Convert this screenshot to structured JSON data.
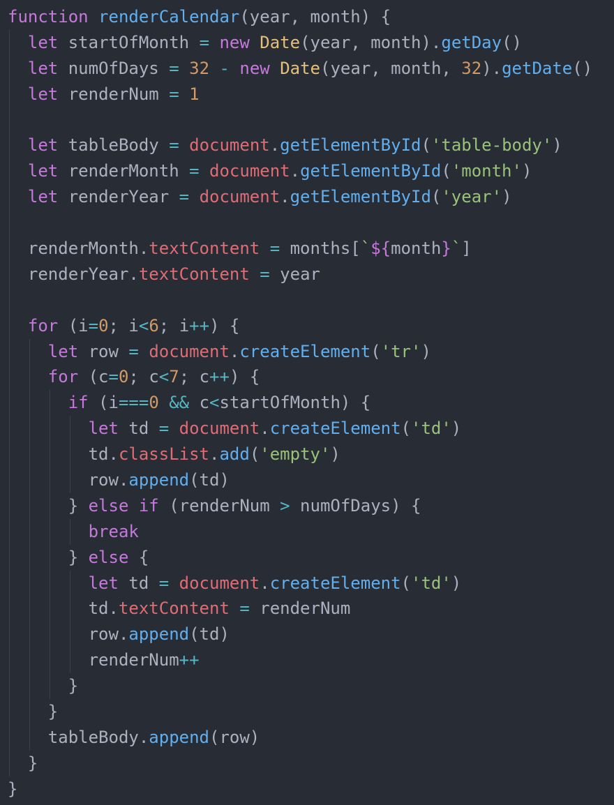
{
  "editor": {
    "colors": {
      "background": "#282c34",
      "plain": "#abb2bf",
      "keyword": "#c678dd",
      "function": "#61afef",
      "class": "#e5c07b",
      "number": "#d19a66",
      "string": "#98c379",
      "property": "#e06c75",
      "operator": "#56b6c2",
      "indent_guide": "#3b4048"
    },
    "lines": [
      {
        "indent": 0,
        "tokens": [
          {
            "t": "function",
            "c": "keyword"
          },
          {
            "t": " ",
            "c": "plain"
          },
          {
            "t": "renderCalendar",
            "c": "func"
          },
          {
            "t": "(year, month) {",
            "c": "plain"
          }
        ]
      },
      {
        "indent": 1,
        "tokens": [
          {
            "t": "let",
            "c": "keyword"
          },
          {
            "t": " startOfMonth ",
            "c": "plain"
          },
          {
            "t": "=",
            "c": "op"
          },
          {
            "t": " ",
            "c": "plain"
          },
          {
            "t": "new",
            "c": "keyword"
          },
          {
            "t": " ",
            "c": "plain"
          },
          {
            "t": "Date",
            "c": "class"
          },
          {
            "t": "(year, month).",
            "c": "plain"
          },
          {
            "t": "getDay",
            "c": "method"
          },
          {
            "t": "()",
            "c": "plain"
          }
        ]
      },
      {
        "indent": 1,
        "tokens": [
          {
            "t": "let",
            "c": "keyword"
          },
          {
            "t": " numOfDays ",
            "c": "plain"
          },
          {
            "t": "=",
            "c": "op"
          },
          {
            "t": " ",
            "c": "plain"
          },
          {
            "t": "32",
            "c": "num"
          },
          {
            "t": " ",
            "c": "plain"
          },
          {
            "t": "-",
            "c": "op"
          },
          {
            "t": " ",
            "c": "plain"
          },
          {
            "t": "new",
            "c": "keyword"
          },
          {
            "t": " ",
            "c": "plain"
          },
          {
            "t": "Date",
            "c": "class"
          },
          {
            "t": "(year, month, ",
            "c": "plain"
          },
          {
            "t": "32",
            "c": "num"
          },
          {
            "t": ").",
            "c": "plain"
          },
          {
            "t": "getDate",
            "c": "method"
          },
          {
            "t": "()",
            "c": "plain"
          }
        ]
      },
      {
        "indent": 1,
        "tokens": [
          {
            "t": "let",
            "c": "keyword"
          },
          {
            "t": " renderNum ",
            "c": "plain"
          },
          {
            "t": "=",
            "c": "op"
          },
          {
            "t": " ",
            "c": "plain"
          },
          {
            "t": "1",
            "c": "num"
          }
        ]
      },
      {
        "indent": 1,
        "tokens": []
      },
      {
        "indent": 1,
        "tokens": [
          {
            "t": "let",
            "c": "keyword"
          },
          {
            "t": " tableBody ",
            "c": "plain"
          },
          {
            "t": "=",
            "c": "op"
          },
          {
            "t": " ",
            "c": "plain"
          },
          {
            "t": "document",
            "c": "builtin"
          },
          {
            "t": ".",
            "c": "plain"
          },
          {
            "t": "getElementById",
            "c": "method"
          },
          {
            "t": "(",
            "c": "plain"
          },
          {
            "t": "'table-body'",
            "c": "str"
          },
          {
            "t": ")",
            "c": "plain"
          }
        ]
      },
      {
        "indent": 1,
        "tokens": [
          {
            "t": "let",
            "c": "keyword"
          },
          {
            "t": " renderMonth ",
            "c": "plain"
          },
          {
            "t": "=",
            "c": "op"
          },
          {
            "t": " ",
            "c": "plain"
          },
          {
            "t": "document",
            "c": "builtin"
          },
          {
            "t": ".",
            "c": "plain"
          },
          {
            "t": "getElementById",
            "c": "method"
          },
          {
            "t": "(",
            "c": "plain"
          },
          {
            "t": "'month'",
            "c": "str"
          },
          {
            "t": ")",
            "c": "plain"
          }
        ]
      },
      {
        "indent": 1,
        "tokens": [
          {
            "t": "let",
            "c": "keyword"
          },
          {
            "t": " renderYear ",
            "c": "plain"
          },
          {
            "t": "=",
            "c": "op"
          },
          {
            "t": " ",
            "c": "plain"
          },
          {
            "t": "document",
            "c": "builtin"
          },
          {
            "t": ".",
            "c": "plain"
          },
          {
            "t": "getElementById",
            "c": "method"
          },
          {
            "t": "(",
            "c": "plain"
          },
          {
            "t": "'year'",
            "c": "str"
          },
          {
            "t": ")",
            "c": "plain"
          }
        ]
      },
      {
        "indent": 1,
        "tokens": []
      },
      {
        "indent": 1,
        "tokens": [
          {
            "t": "renderMonth.",
            "c": "plain"
          },
          {
            "t": "textContent",
            "c": "prop"
          },
          {
            "t": " ",
            "c": "plain"
          },
          {
            "t": "=",
            "c": "op"
          },
          {
            "t": " months[",
            "c": "plain"
          },
          {
            "t": "`",
            "c": "str"
          },
          {
            "t": "${",
            "c": "interp"
          },
          {
            "t": "month",
            "c": "plain"
          },
          {
            "t": "}",
            "c": "interp"
          },
          {
            "t": "`",
            "c": "str"
          },
          {
            "t": "]",
            "c": "plain"
          }
        ]
      },
      {
        "indent": 1,
        "tokens": [
          {
            "t": "renderYear.",
            "c": "plain"
          },
          {
            "t": "textContent",
            "c": "prop"
          },
          {
            "t": " ",
            "c": "plain"
          },
          {
            "t": "=",
            "c": "op"
          },
          {
            "t": " year",
            "c": "plain"
          }
        ]
      },
      {
        "indent": 1,
        "tokens": []
      },
      {
        "indent": 1,
        "tokens": [
          {
            "t": "for",
            "c": "keyword"
          },
          {
            "t": " (i",
            "c": "plain"
          },
          {
            "t": "=",
            "c": "op"
          },
          {
            "t": "0",
            "c": "num"
          },
          {
            "t": "; i",
            "c": "plain"
          },
          {
            "t": "<",
            "c": "op"
          },
          {
            "t": "6",
            "c": "num"
          },
          {
            "t": "; i",
            "c": "plain"
          },
          {
            "t": "++",
            "c": "op"
          },
          {
            "t": ") {",
            "c": "plain"
          }
        ]
      },
      {
        "indent": 2,
        "tokens": [
          {
            "t": "let",
            "c": "keyword"
          },
          {
            "t": " row ",
            "c": "plain"
          },
          {
            "t": "=",
            "c": "op"
          },
          {
            "t": " ",
            "c": "plain"
          },
          {
            "t": "document",
            "c": "builtin"
          },
          {
            "t": ".",
            "c": "plain"
          },
          {
            "t": "createElement",
            "c": "method"
          },
          {
            "t": "(",
            "c": "plain"
          },
          {
            "t": "'tr'",
            "c": "str"
          },
          {
            "t": ")",
            "c": "plain"
          }
        ]
      },
      {
        "indent": 2,
        "tokens": [
          {
            "t": "for",
            "c": "keyword"
          },
          {
            "t": " (c",
            "c": "plain"
          },
          {
            "t": "=",
            "c": "op"
          },
          {
            "t": "0",
            "c": "num"
          },
          {
            "t": "; c",
            "c": "plain"
          },
          {
            "t": "<",
            "c": "op"
          },
          {
            "t": "7",
            "c": "num"
          },
          {
            "t": "; c",
            "c": "plain"
          },
          {
            "t": "++",
            "c": "op"
          },
          {
            "t": ") {",
            "c": "plain"
          }
        ]
      },
      {
        "indent": 3,
        "tokens": [
          {
            "t": "if",
            "c": "keyword"
          },
          {
            "t": " (i",
            "c": "plain"
          },
          {
            "t": "===",
            "c": "op"
          },
          {
            "t": "0",
            "c": "num"
          },
          {
            "t": " ",
            "c": "plain"
          },
          {
            "t": "&&",
            "c": "op"
          },
          {
            "t": " c",
            "c": "plain"
          },
          {
            "t": "<",
            "c": "op"
          },
          {
            "t": "startOfMonth) {",
            "c": "plain"
          }
        ]
      },
      {
        "indent": 4,
        "tokens": [
          {
            "t": "let",
            "c": "keyword"
          },
          {
            "t": " td ",
            "c": "plain"
          },
          {
            "t": "=",
            "c": "op"
          },
          {
            "t": " ",
            "c": "plain"
          },
          {
            "t": "document",
            "c": "builtin"
          },
          {
            "t": ".",
            "c": "plain"
          },
          {
            "t": "createElement",
            "c": "method"
          },
          {
            "t": "(",
            "c": "plain"
          },
          {
            "t": "'td'",
            "c": "str"
          },
          {
            "t": ")",
            "c": "plain"
          }
        ]
      },
      {
        "indent": 4,
        "tokens": [
          {
            "t": "td.",
            "c": "plain"
          },
          {
            "t": "classList",
            "c": "prop"
          },
          {
            "t": ".",
            "c": "plain"
          },
          {
            "t": "add",
            "c": "method"
          },
          {
            "t": "(",
            "c": "plain"
          },
          {
            "t": "'empty'",
            "c": "str"
          },
          {
            "t": ")",
            "c": "plain"
          }
        ]
      },
      {
        "indent": 4,
        "tokens": [
          {
            "t": "row.",
            "c": "plain"
          },
          {
            "t": "append",
            "c": "method"
          },
          {
            "t": "(td)",
            "c": "plain"
          }
        ]
      },
      {
        "indent": 3,
        "tokens": [
          {
            "t": "} ",
            "c": "plain"
          },
          {
            "t": "else",
            "c": "keyword"
          },
          {
            "t": " ",
            "c": "plain"
          },
          {
            "t": "if",
            "c": "keyword"
          },
          {
            "t": " (renderNum ",
            "c": "plain"
          },
          {
            "t": ">",
            "c": "op"
          },
          {
            "t": " numOfDays) {",
            "c": "plain"
          }
        ]
      },
      {
        "indent": 4,
        "tokens": [
          {
            "t": "break",
            "c": "keyword"
          }
        ]
      },
      {
        "indent": 3,
        "tokens": [
          {
            "t": "} ",
            "c": "plain"
          },
          {
            "t": "else",
            "c": "keyword"
          },
          {
            "t": " {",
            "c": "plain"
          }
        ]
      },
      {
        "indent": 4,
        "tokens": [
          {
            "t": "let",
            "c": "keyword"
          },
          {
            "t": " td ",
            "c": "plain"
          },
          {
            "t": "=",
            "c": "op"
          },
          {
            "t": " ",
            "c": "plain"
          },
          {
            "t": "document",
            "c": "builtin"
          },
          {
            "t": ".",
            "c": "plain"
          },
          {
            "t": "createElement",
            "c": "method"
          },
          {
            "t": "(",
            "c": "plain"
          },
          {
            "t": "'td'",
            "c": "str"
          },
          {
            "t": ")",
            "c": "plain"
          }
        ]
      },
      {
        "indent": 4,
        "tokens": [
          {
            "t": "td.",
            "c": "plain"
          },
          {
            "t": "textContent",
            "c": "prop"
          },
          {
            "t": " ",
            "c": "plain"
          },
          {
            "t": "=",
            "c": "op"
          },
          {
            "t": " renderNum",
            "c": "plain"
          }
        ]
      },
      {
        "indent": 4,
        "tokens": [
          {
            "t": "row.",
            "c": "plain"
          },
          {
            "t": "append",
            "c": "method"
          },
          {
            "t": "(td)",
            "c": "plain"
          }
        ]
      },
      {
        "indent": 4,
        "tokens": [
          {
            "t": "renderNum",
            "c": "plain"
          },
          {
            "t": "++",
            "c": "op"
          }
        ]
      },
      {
        "indent": 3,
        "tokens": [
          {
            "t": "}",
            "c": "plain"
          }
        ]
      },
      {
        "indent": 2,
        "tokens": [
          {
            "t": "}",
            "c": "plain"
          }
        ]
      },
      {
        "indent": 2,
        "tokens": [
          {
            "t": "tableBody.",
            "c": "plain"
          },
          {
            "t": "append",
            "c": "method"
          },
          {
            "t": "(row)",
            "c": "plain"
          }
        ]
      },
      {
        "indent": 1,
        "tokens": [
          {
            "t": "}",
            "c": "plain"
          }
        ]
      },
      {
        "indent": 0,
        "tokens": [
          {
            "t": "}",
            "c": "plain"
          }
        ]
      }
    ]
  }
}
